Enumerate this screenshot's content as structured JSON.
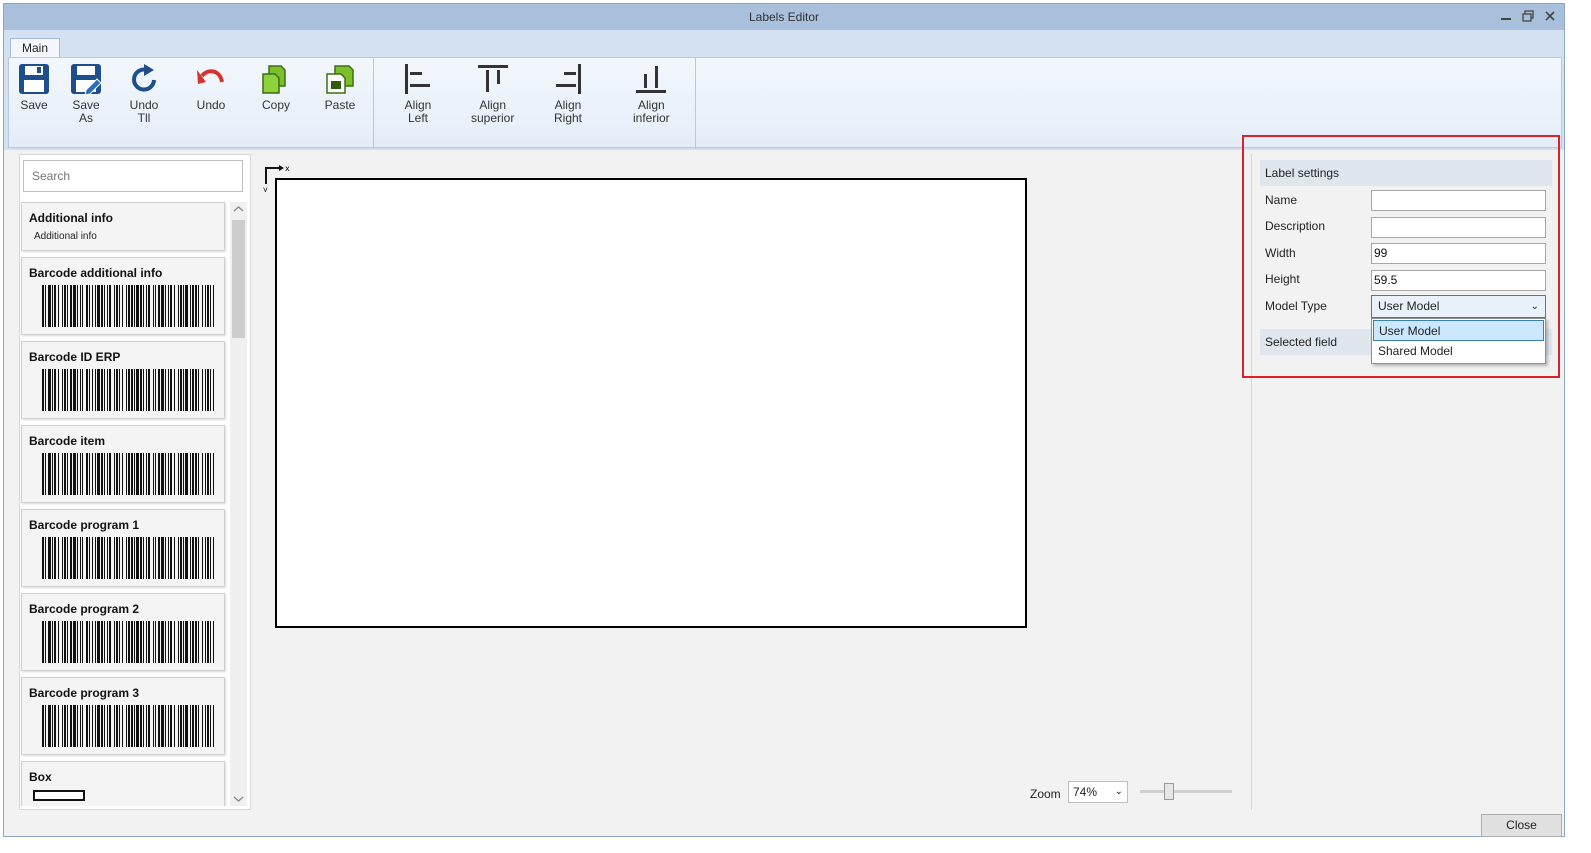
{
  "window": {
    "title": "Labels Editor"
  },
  "ribbon": {
    "tab": "Main",
    "buttons": [
      {
        "label": "Save",
        "icon": "save-icon"
      },
      {
        "label": "Save\nAs",
        "icon": "save-as-icon"
      },
      {
        "label": "Undo\nTll",
        "icon": "undo-all-icon"
      },
      {
        "label": "Undo",
        "icon": "undo-icon"
      },
      {
        "label": "Copy",
        "icon": "copy-icon"
      },
      {
        "label": "Paste",
        "icon": "paste-icon"
      },
      {
        "label": "Align\nLeft",
        "icon": "align-left-icon"
      },
      {
        "label": "Align\nsuperior",
        "icon": "align-top-icon"
      },
      {
        "label": "Align\nRight",
        "icon": "align-right-icon"
      },
      {
        "label": "Align\ninferior",
        "icon": "align-bottom-icon"
      }
    ]
  },
  "fields": {
    "search_placeholder": "Search",
    "items": [
      {
        "title": "Additional info",
        "subtitle": "Additional info"
      },
      {
        "title": "Barcode additional info"
      },
      {
        "title": "Barcode ID ERP"
      },
      {
        "title": "Barcode item"
      },
      {
        "title": "Barcode program 1"
      },
      {
        "title": "Barcode program 2"
      },
      {
        "title": "Barcode program 3"
      },
      {
        "title": "Box"
      }
    ]
  },
  "canvas": {
    "axis_x": "x",
    "axis_y": "y"
  },
  "zoom": {
    "label": "Zoom",
    "value": "74%"
  },
  "settings": {
    "header": "Label settings",
    "name_label": "Name",
    "name_value": "",
    "description_label": "Description",
    "description_value": "",
    "width_label": "Width",
    "width_value": "99",
    "height_label": "Height",
    "height_value": "59.5",
    "model_type_label": "Model Type",
    "model_type_value": "User Model",
    "model_type_options": [
      "User Model",
      "Shared Model"
    ],
    "selected_field_header": "Selected field"
  },
  "footer": {
    "close_label": "Close"
  },
  "colors": {
    "highlight": "#d9222a",
    "titlebar": "#a9c0dd",
    "ribbon": "#d4e1f2"
  }
}
